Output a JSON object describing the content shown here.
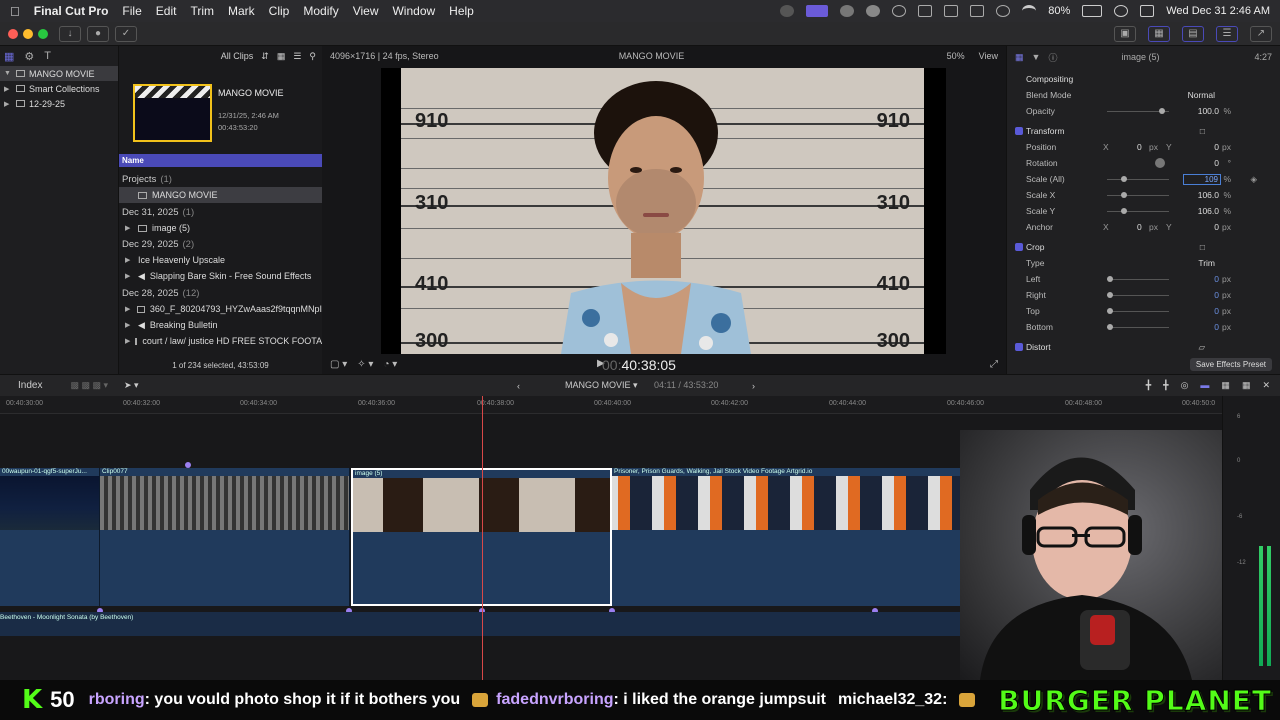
{
  "menubar": {
    "app_name": "Final Cut Pro",
    "menus": [
      "File",
      "Edit",
      "Trim",
      "Mark",
      "Clip",
      "Modify",
      "View",
      "Window",
      "Help"
    ],
    "battery": "80%",
    "datetime": "Wed Dec 31  2:46 AM"
  },
  "libraries": {
    "items": [
      {
        "label": "MANGO MOVIE"
      },
      {
        "label": "Smart Collections"
      },
      {
        "label": "12-29-25"
      }
    ]
  },
  "browser": {
    "filter_label": "All Clips",
    "thumb_title": "MANGO MOVIE",
    "thumb_date": "12/31/25, 2:46 AM",
    "thumb_duration": "00:43:53:20",
    "column_name": "Name",
    "groups": [
      {
        "label": "Projects",
        "count": "(1)"
      },
      {
        "label": "Dec 31, 2025",
        "count": "(1)"
      },
      {
        "label": "Dec 29, 2025",
        "count": "(2)"
      },
      {
        "label": "Dec 28, 2025",
        "count": "(12)"
      }
    ],
    "items": [
      {
        "label": "MANGO MOVIE"
      },
      {
        "label": "image (5)"
      },
      {
        "label": "Ice Heavenly Upscale"
      },
      {
        "label": "Slapping Bare Skin - Free Sound Effects"
      },
      {
        "label": "360_F_80204793_HYZwAaas2f9tqqnMNpI"
      },
      {
        "label": "Breaking Bulletin"
      },
      {
        "label": "court / law/ justice HD FREE STOCK FOOTA"
      }
    ],
    "footer": "1 of 234 selected, 43:53:09"
  },
  "viewer": {
    "format": "4096×1716 | 24 fps, Stereo",
    "project_title": "MANGO MOVIE",
    "zoom": "50%",
    "view_label": "View",
    "timecode_dim": "00:",
    "timecode": "40:38:05",
    "height_marks": [
      "910",
      "310",
      "410",
      "300"
    ]
  },
  "inspector": {
    "clip_name": "image (5)",
    "duration": "4:27",
    "compositing": "Compositing",
    "blend_mode_label": "Blend Mode",
    "blend_mode_value": "Normal",
    "opacity_label": "Opacity",
    "opacity_value": "100.0",
    "opacity_unit": "%",
    "transform": "Transform",
    "position_label": "Position",
    "position_x": "0",
    "position_y": "0",
    "rotation_label": "Rotation",
    "rotation_value": "0",
    "rotation_unit": "°",
    "scale_all_label": "Scale (All)",
    "scale_all_value": "109",
    "scale_x_label": "Scale X",
    "scale_x_value": "106.0",
    "scale_y_label": "Scale Y",
    "scale_y_value": "106.0",
    "anchor_label": "Anchor",
    "anchor_x": "0",
    "anchor_y": "0",
    "crop": "Crop",
    "type_label": "Type",
    "type_value": "Trim",
    "left_label": "Left",
    "right_label": "Right",
    "top_label": "Top",
    "bottom_label": "Bottom",
    "crop_value": "0",
    "distort": "Distort",
    "save_preset": "Save Effects Preset",
    "x_label": "X",
    "y_label": "Y",
    "px_unit": "px",
    "pct_unit": "%"
  },
  "timeline": {
    "index_label": "Index",
    "project_name": "MANGO MOVIE",
    "project_time": "04:11 / 43:53:20",
    "ruler_ticks": [
      "00:40:30:00",
      "00:40:32:00",
      "00:40:34:00",
      "00:40:36:00",
      "00:40:38:00",
      "00:40:40:00",
      "00:40:42:00",
      "00:40:44:00",
      "00:40:46:00",
      "00:40:48:00",
      "00:40:50:0"
    ],
    "clips": [
      {
        "title": "00waupun-01-qgf5-superJu..."
      },
      {
        "title": "Clip0077"
      },
      {
        "title": "image (5)"
      },
      {
        "title": "Prisoner, Prison Guards, Walking, Jail  Stock Video Footage  Artgrid.io"
      }
    ],
    "audio_title": "Beethoven - Moonlight Sonata (by Beethoven)",
    "meter_labels": [
      "6",
      "0",
      "-6",
      "-12"
    ]
  },
  "ticker": {
    "k_glyph": "K",
    "viewer_count": "50",
    "messages": [
      {
        "user": "rboring",
        "text": " : you vould photo shop it if it bothers you"
      },
      {
        "user": "fadednvrboring",
        "text": " : i liked the orange jumpsuit"
      },
      {
        "user": "michael32_32",
        "text": " : "
      }
    ],
    "brand": "BURGER PLANET"
  },
  "colors": {
    "accent": "#5a5ad8",
    "selection_yellow": "#f2c21b",
    "playhead": "#d84848",
    "kick_green": "#53fc18"
  }
}
